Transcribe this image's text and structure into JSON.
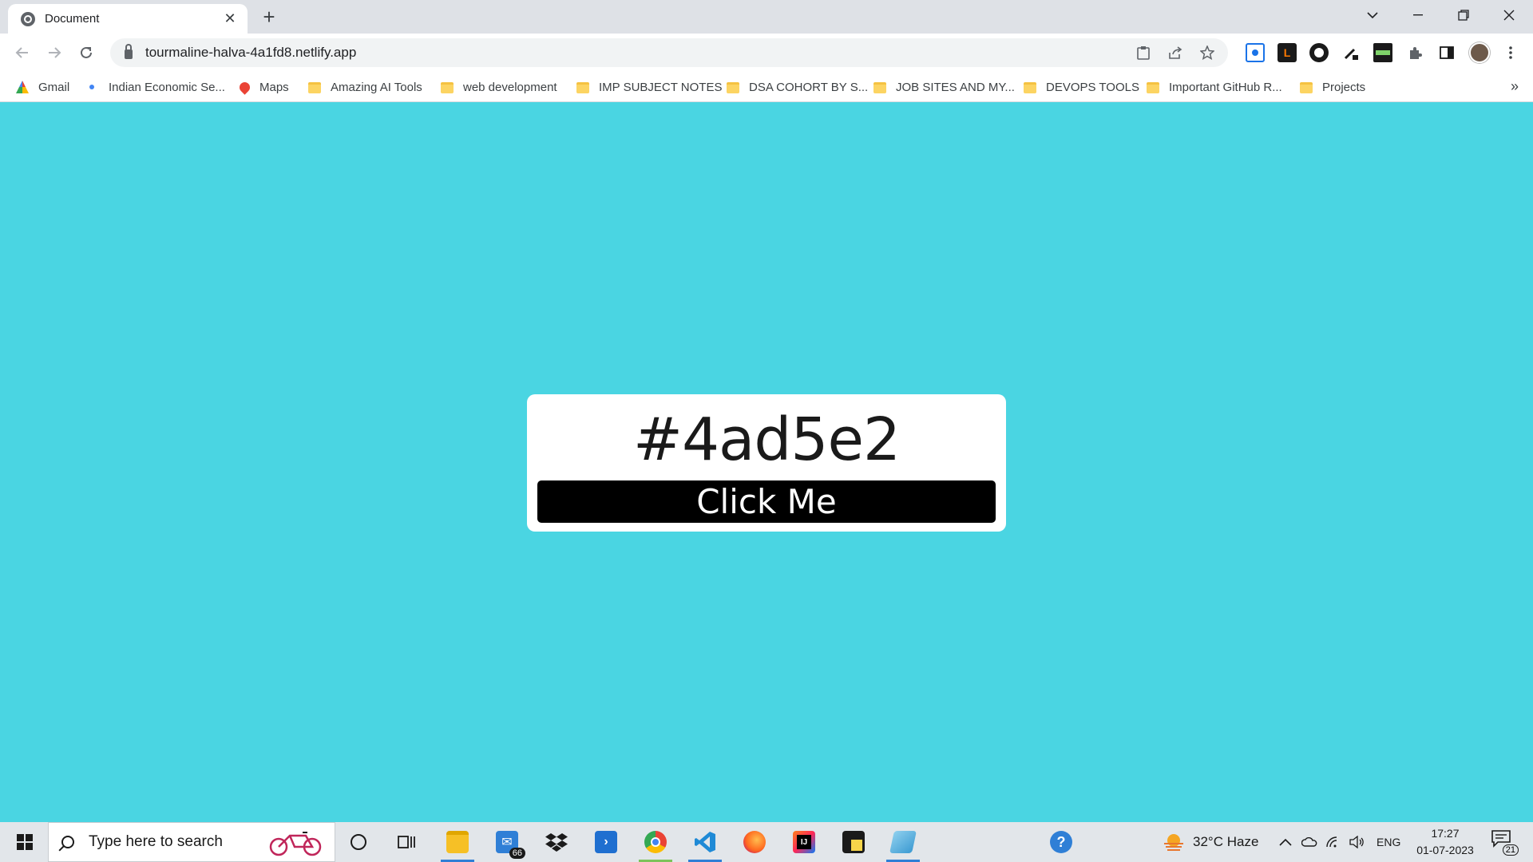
{
  "browser": {
    "tab_title": "Document",
    "tab_close": "✕",
    "new_tab": "+",
    "url": "tourmaline-halva-4a1fd8.netlify.app",
    "bookmarks": [
      {
        "label": "Gmail",
        "icon": "gmail-icon"
      },
      {
        "label": "Indian Economic Se...",
        "icon": "site-icon"
      },
      {
        "label": "Maps",
        "icon": "maps-icon"
      },
      {
        "label": "Amazing AI Tools",
        "icon": "folder-icon"
      },
      {
        "label": "web development",
        "icon": "folder-icon"
      },
      {
        "label": "IMP SUBJECT NOTES",
        "icon": "folder-icon"
      },
      {
        "label": "DSA COHORT BY S...",
        "icon": "folder-icon"
      },
      {
        "label": "JOB SITES AND MY...",
        "icon": "folder-icon"
      },
      {
        "label": "DEVOPS TOOLS",
        "icon": "folder-icon"
      },
      {
        "label": "Important GitHub R...",
        "icon": "folder-icon"
      },
      {
        "label": "Projects",
        "icon": "folder-icon"
      }
    ],
    "more_bookmarks": "»"
  },
  "page": {
    "background_color": "#4ad5e2",
    "color_code": "#4ad5e2",
    "button_label": "Click Me"
  },
  "taskbar": {
    "search_placeholder": "Type here to search",
    "mail_badge": "66",
    "weather": "32°C  Haze",
    "language": "ENG",
    "time": "17:27",
    "date": "01-07-2023",
    "notifications": "21"
  }
}
